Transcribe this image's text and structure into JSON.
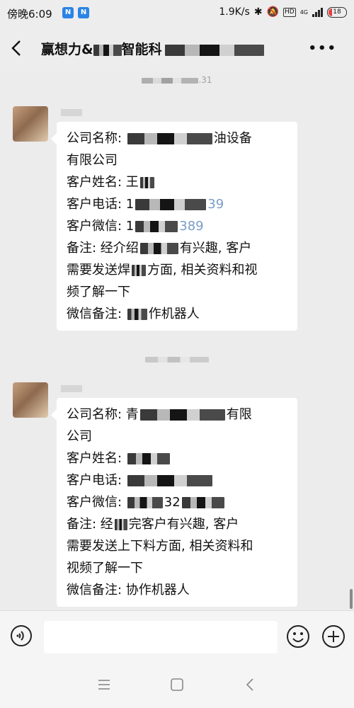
{
  "status_bar": {
    "time": "傍晚6:09",
    "app_icon_letter": "N",
    "net_speed": "1.9K/s",
    "network": "4G",
    "hd": "HD",
    "battery": "18"
  },
  "header": {
    "title_prefix": "赢想力&",
    "title_mid": "智能科"
  },
  "chat": {
    "time_label_suffix": ".31",
    "messages": [
      {
        "lines": [
          {
            "before": "公司名称: ",
            "after": "油设备"
          },
          {
            "before": "有限公司",
            "after": ""
          },
          {
            "before": "客户姓名: 王",
            "after": ""
          },
          {
            "before": "客户电话: 1",
            "after": "39"
          },
          {
            "before": "客户微信: 1",
            "after": "389"
          },
          {
            "before": "备注: 经介绍",
            "after": "有兴趣, 客户"
          },
          {
            "before": "需要发送焊",
            "after": "方面, 相关资料和视"
          },
          {
            "before": "频了解一下",
            "after": ""
          },
          {
            "before": "微信备注: ",
            "after": "作机器人"
          }
        ]
      },
      {
        "lines": [
          {
            "before": "公司名称: 青",
            "after": "有限"
          },
          {
            "before": "公司",
            "after": ""
          },
          {
            "before": "客户姓名: ",
            "after": ""
          },
          {
            "before": "客户电话: ",
            "after": ""
          },
          {
            "before": "客户微信: ",
            "after": "32"
          },
          {
            "before": "备注: 经",
            "after": "完客户有兴趣, 客户"
          },
          {
            "before": "需要发送上下料方面, 相关资料和",
            "after": ""
          },
          {
            "before": "视频了解一下",
            "after": ""
          },
          {
            "before": "微信备注: 协作机器人",
            "after": ""
          }
        ]
      }
    ]
  },
  "colors": {
    "background": "#ececec",
    "bubble": "#ffffff",
    "app_badge": "#2b83e6"
  },
  "icons": [
    "back-icon",
    "more-icon",
    "voice-icon",
    "emoji-icon",
    "plus-icon",
    "menu-icon",
    "home-icon",
    "nav-back-icon"
  ]
}
